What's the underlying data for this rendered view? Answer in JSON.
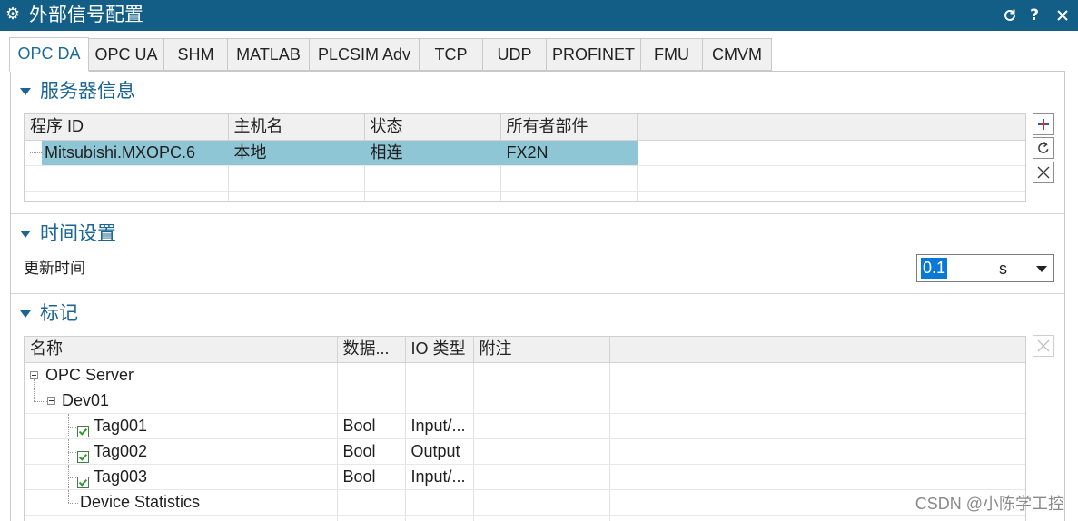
{
  "colors": {
    "titlebar": "#125e86",
    "accent": "#1b6592",
    "row_selected": "#8fc6d5",
    "text_selection": "#0a78d7",
    "check": "#2d9a2d"
  },
  "window": {
    "title": "外部信号配置",
    "icon": "gear-icon",
    "help_label": "?",
    "control_icons": [
      "refresh-icon",
      "close-icon"
    ]
  },
  "tabs": [
    {
      "label": "OPC DA",
      "active": true
    },
    {
      "label": "OPC UA",
      "active": false
    },
    {
      "label": "SHM",
      "active": false
    },
    {
      "label": "MATLAB",
      "active": false
    },
    {
      "label": "PLCSIM Adv",
      "active": false
    },
    {
      "label": "TCP",
      "active": false
    },
    {
      "label": "UDP",
      "active": false
    },
    {
      "label": "PROFINET",
      "active": false
    },
    {
      "label": "FMU",
      "active": false
    },
    {
      "label": "CMVM",
      "active": false
    }
  ],
  "server_info": {
    "title": "服务器信息",
    "expanded": true,
    "columns": [
      "程序 ID",
      "主机名",
      "状态",
      "所有者部件"
    ],
    "rows": [
      {
        "program_id": "Mitsubishi.MXOPC.6",
        "host": "本地",
        "status": "相连",
        "owner": "FX2N",
        "selected": true
      }
    ],
    "action_icons": [
      "add-server-icon",
      "refresh-icon",
      "delete-icon"
    ]
  },
  "time_settings": {
    "title": "时间设置",
    "expanded": true,
    "update_time_label": "更新时间",
    "update_time_value": "0.1",
    "update_time_unit": "s"
  },
  "tags": {
    "title": "标记",
    "expanded": true,
    "columns": [
      "名称",
      "数据...",
      "IO 类型",
      "附注"
    ],
    "tree": {
      "name": "OPC Server",
      "expanded": true,
      "children": [
        {
          "name": "Dev01",
          "expanded": true,
          "children": [
            {
              "name": "Tag001",
              "checked": true,
              "data_type": "Bool",
              "io_type": "Input/..."
            },
            {
              "name": "Tag002",
              "checked": true,
              "data_type": "Bool",
              "io_type": "Output"
            },
            {
              "name": "Tag003",
              "checked": true,
              "data_type": "Bool",
              "io_type": "Input/..."
            },
            {
              "name": "Device Statistics"
            }
          ]
        }
      ]
    },
    "action_icons": [
      "delete-icon"
    ]
  },
  "watermark": "CSDN @小陈学工控"
}
